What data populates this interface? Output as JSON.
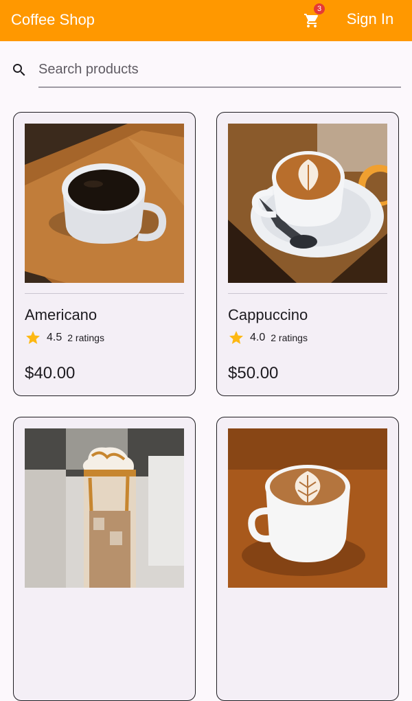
{
  "app": {
    "title": "Coffee Shop",
    "cart_count": "3",
    "sign_in_label": "Sign In",
    "accent_color": "#ff9800"
  },
  "search": {
    "placeholder": "Search products",
    "value": ""
  },
  "products": [
    {
      "name": "Americano",
      "rating": "4.5",
      "ratings_count": "2 ratings",
      "price": "$40.00",
      "image": "americano-photo"
    },
    {
      "name": "Cappuccino",
      "rating": "4.0",
      "ratings_count": "2 ratings",
      "price": "$50.00",
      "image": "cappuccino-photo"
    },
    {
      "name": "",
      "rating": "",
      "ratings_count": "",
      "price": "",
      "image": "iced-coffee-photo"
    },
    {
      "name": "",
      "rating": "",
      "ratings_count": "",
      "price": "",
      "image": "latte-art-photo"
    }
  ],
  "icons": {
    "cart": "shopping-cart-icon",
    "search": "search-icon",
    "star": "star-icon"
  }
}
